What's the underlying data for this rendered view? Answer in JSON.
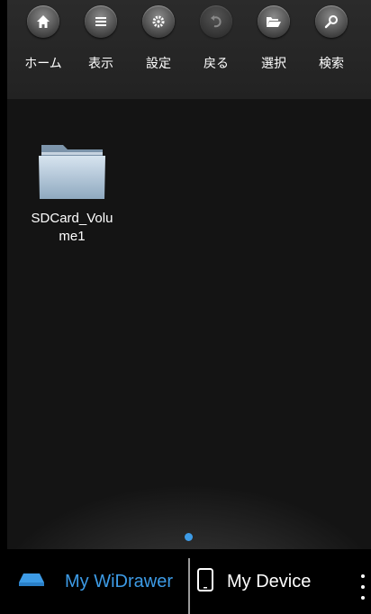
{
  "toolbar": {
    "items": [
      {
        "label": "ホーム",
        "icon": "home-icon"
      },
      {
        "label": "表示",
        "icon": "list-icon"
      },
      {
        "label": "設定",
        "icon": "gear-icon"
      },
      {
        "label": "戻る",
        "icon": "back-icon"
      },
      {
        "label": "選択",
        "icon": "folder-open-icon"
      },
      {
        "label": "検索",
        "icon": "search-icon"
      }
    ]
  },
  "main": {
    "folder": {
      "name": "SDCard_Volume1",
      "icon": "folder-icon"
    }
  },
  "pager": {
    "active_color": "#3d9be6"
  },
  "bottom_tabs": {
    "wi_label": "My WiDrawer",
    "device_label": "My Device",
    "active_color": "#3d9be6"
  }
}
